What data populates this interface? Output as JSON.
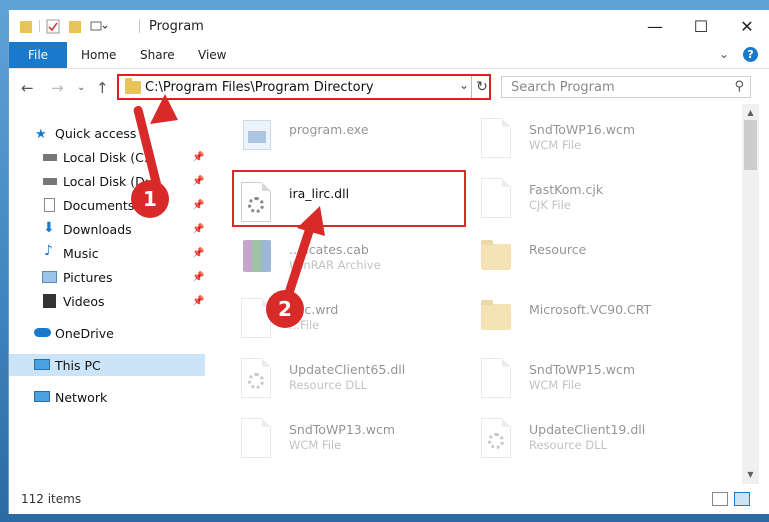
{
  "window": {
    "title": "Program",
    "controls": {
      "minimize": "—",
      "maximize": "☐",
      "close": "✕"
    }
  },
  "ribbon": {
    "file": "File",
    "tabs": [
      "Home",
      "Share",
      "View"
    ],
    "help": "?"
  },
  "addressbar": {
    "path": "C:\\Program Files\\Program Directory",
    "search_placeholder": "Search Program"
  },
  "nav": {
    "quick_access": "Quick access",
    "items": [
      {
        "label": "Local Disk (C:)",
        "icon": "drive-icon"
      },
      {
        "label": "Local Disk (D:)",
        "icon": "drive-icon"
      },
      {
        "label": "Documents",
        "icon": "documents-icon"
      },
      {
        "label": "Downloads",
        "icon": "downloads-icon"
      },
      {
        "label": "Music",
        "icon": "music-icon"
      },
      {
        "label": "Pictures",
        "icon": "pictures-icon"
      },
      {
        "label": "Videos",
        "icon": "videos-icon"
      }
    ],
    "onedrive": "OneDrive",
    "this_pc": "This PC",
    "network": "Network"
  },
  "files": [
    {
      "name": "program.exe",
      "type": "",
      "icon": "exe-icon"
    },
    {
      "name": "SndToWP16.wcm",
      "type": "WCM File",
      "icon": "file-icon"
    },
    {
      "name": "ira_lirc.dll",
      "type": "",
      "icon": "dll-icon"
    },
    {
      "name": "FastKom.cjk",
      "type": "CJK File",
      "icon": "file-icon"
    },
    {
      "name": "...ficates.cab",
      "type": "WinRAR Archive",
      "icon": "rar-icon"
    },
    {
      "name": "Resource",
      "type": "",
      "icon": "folder-icon"
    },
    {
      "name": "...ic.wrd",
      "type": "...File",
      "icon": "file-icon"
    },
    {
      "name": "Microsoft.VC90.CRT",
      "type": "",
      "icon": "folder-icon"
    },
    {
      "name": "UpdateClient65.dll",
      "type": "Resource DLL",
      "icon": "dll-icon"
    },
    {
      "name": "SndToWP15.wcm",
      "type": "WCM File",
      "icon": "file-icon"
    },
    {
      "name": "SndToWP13.wcm",
      "type": "WCM File",
      "icon": "file-icon"
    },
    {
      "name": "UpdateClient19.dll",
      "type": "Resource DLL",
      "icon": "dll-icon"
    }
  ],
  "status": {
    "count": "112 items"
  },
  "annotations": {
    "badge1": "1",
    "badge2": "2"
  },
  "colors": {
    "accent": "#1979ca",
    "highlight": "#d92a2a",
    "selected": "#cce4f7"
  }
}
